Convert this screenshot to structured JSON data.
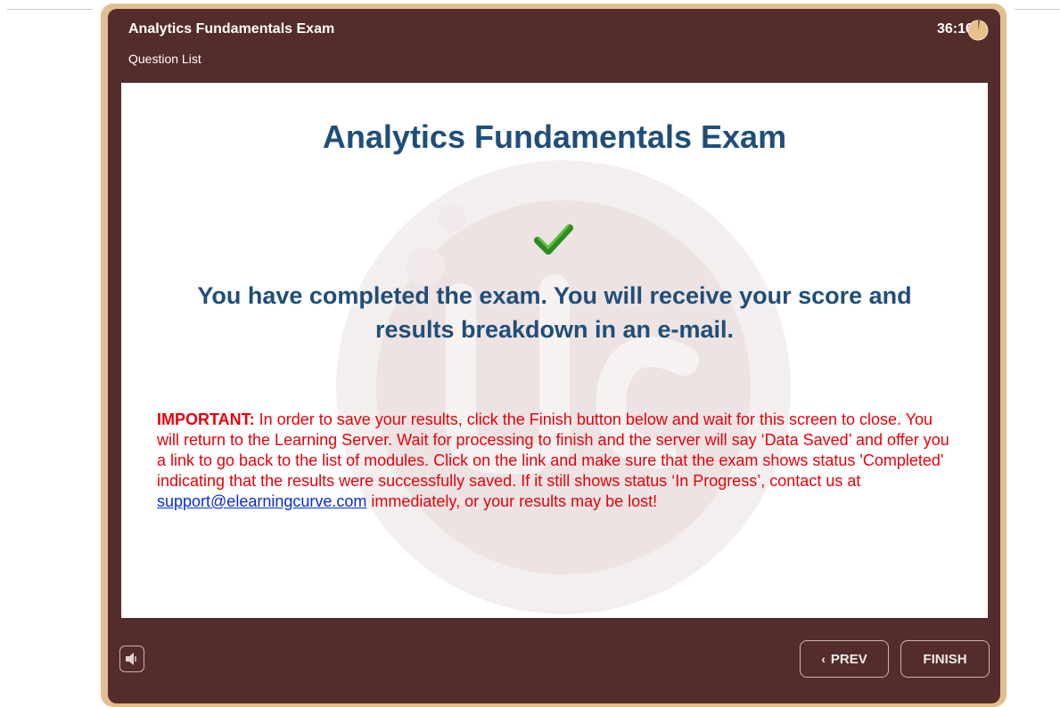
{
  "header": {
    "exam_title": "Analytics Fundamentals Exam",
    "question_list_label": "Question List",
    "timer": "36:10"
  },
  "slide": {
    "title": "Analytics Fundamentals Exam",
    "completion_message": "You have completed the exam. You will receive your score and results breakdown in an e-mail.",
    "important_label": "IMPORTANT:",
    "important_text_before_link": "In order to save your results, click the Finish button below and wait for this screen to close. You will return to the Learning Server.  Wait for   processing to finish and the server will say ‘Data Saved’ and offer you a link to go back to the list of modules. Click on the link and make sure that the exam shows status 'Completed' indicating that the results were successfully saved. If it still shows status ‘In Progress’, contact us at",
    "support_email": "support@elearningcurve.com",
    "important_text_after_link": "immediately, or your results may be lost!",
    "watermark_text": "elc"
  },
  "footer": {
    "prev_label": "PREV",
    "finish_label": "FINISH"
  },
  "icons": {
    "timer": "pie-clock-icon",
    "check": "checkmark-icon",
    "sound": "speaker-icon",
    "prev": "chevron-left-icon"
  },
  "colors": {
    "frame": "#542c2c",
    "frame_border": "#e2bd8e",
    "title_blue": "#1f4e79",
    "warning_red": "#e8000a",
    "check_green": "#2e8b1f",
    "link_blue": "#0a2bd6"
  }
}
